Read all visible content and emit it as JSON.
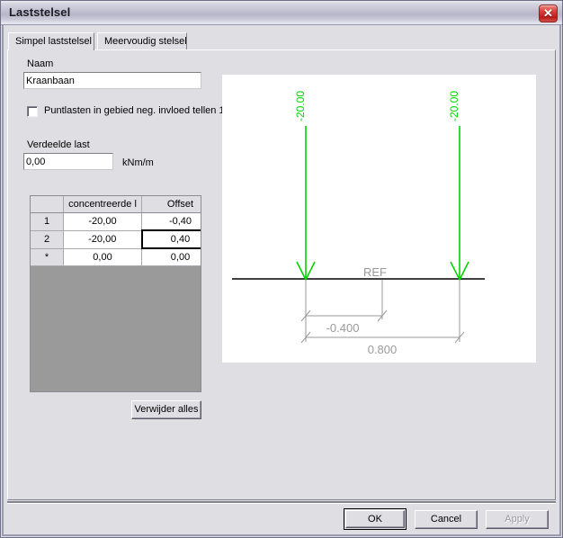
{
  "window": {
    "title": "Laststelsel",
    "close_icon": "close-icon",
    "close_glyph": "✕"
  },
  "tabs": [
    {
      "label": "Simpel laststelsel",
      "selected": true
    },
    {
      "label": "Meervoudig stelsel",
      "selected": false
    }
  ],
  "form": {
    "naam_label": "Naam",
    "naam_value": "Kraanbaan",
    "checkbox_label": "Puntlasten in gebied neg. invloed tellen 1",
    "checkbox_checked": false,
    "verdeelde_last_label": "Verdeelde last",
    "verdeelde_last_value": "0,00",
    "verdeelde_last_unit": "kNm/m"
  },
  "grid": {
    "columns": [
      "",
      "concentreerde l",
      "Offset"
    ],
    "rows": [
      {
        "header": "1",
        "load": "-20,00",
        "offset": "-0,40",
        "selected_cell": null
      },
      {
        "header": "2",
        "load": "-20,00",
        "offset": "0,40",
        "selected_cell": "offset"
      },
      {
        "header": "*",
        "load": "0,00",
        "offset": "0,00",
        "selected_cell": null
      }
    ]
  },
  "buttons": {
    "remove_all": "Verwijder alles",
    "ok": "OK",
    "cancel": "Cancel",
    "apply": "Apply",
    "apply_enabled": false
  },
  "drawing": {
    "reference_label": "REF",
    "load_left_label": "-20.00",
    "load_right_label": "-20.00",
    "dim_inner_label": "-0.400",
    "dim_outer_label": "0.800",
    "arrow_color": "#00d400",
    "line_color": "#000000",
    "dim_color": "#9a9a9a"
  }
}
